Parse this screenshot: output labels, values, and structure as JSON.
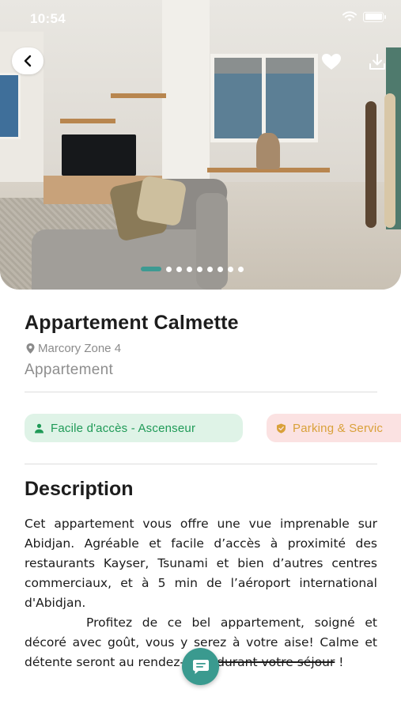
{
  "status_bar": {
    "time": "10:54"
  },
  "gallery": {
    "slide_count": 9,
    "active_index": 0
  },
  "listing": {
    "title": "Appartement Calmette",
    "location": "Marcory Zone 4",
    "type": "Appartement"
  },
  "features": [
    {
      "label": "Facile d'accès - Ascenseur",
      "icon": "person-icon"
    },
    {
      "label": "Parking & Servic",
      "icon": "shield-icon"
    }
  ],
  "description": {
    "heading": "Description",
    "paragraph1": "Cet appartement vous offre une vue imprenable sur Abidjan. Agréable et facile d’accès à proximité des restaurants Kayser, Tsunami et bien d’autres centres commerciaux, et à 5 min de l’aéroport international d'Abidjan.",
    "paragraph2_start": "Profitez de ce bel appartement, soigné et décoré avec goût, vous y serez à votre aise! Calme et détente seront au rendez-vous ",
    "paragraph2_struck": "durant votre séjour",
    "paragraph2_end": " !"
  },
  "colors": {
    "accent": "#3d9a92",
    "chip_green_bg": "#dff3e7",
    "chip_green_text": "#1f9a57",
    "chip_pink_bg": "#fbe2e2",
    "chip_pink_text": "#d9a13a"
  }
}
